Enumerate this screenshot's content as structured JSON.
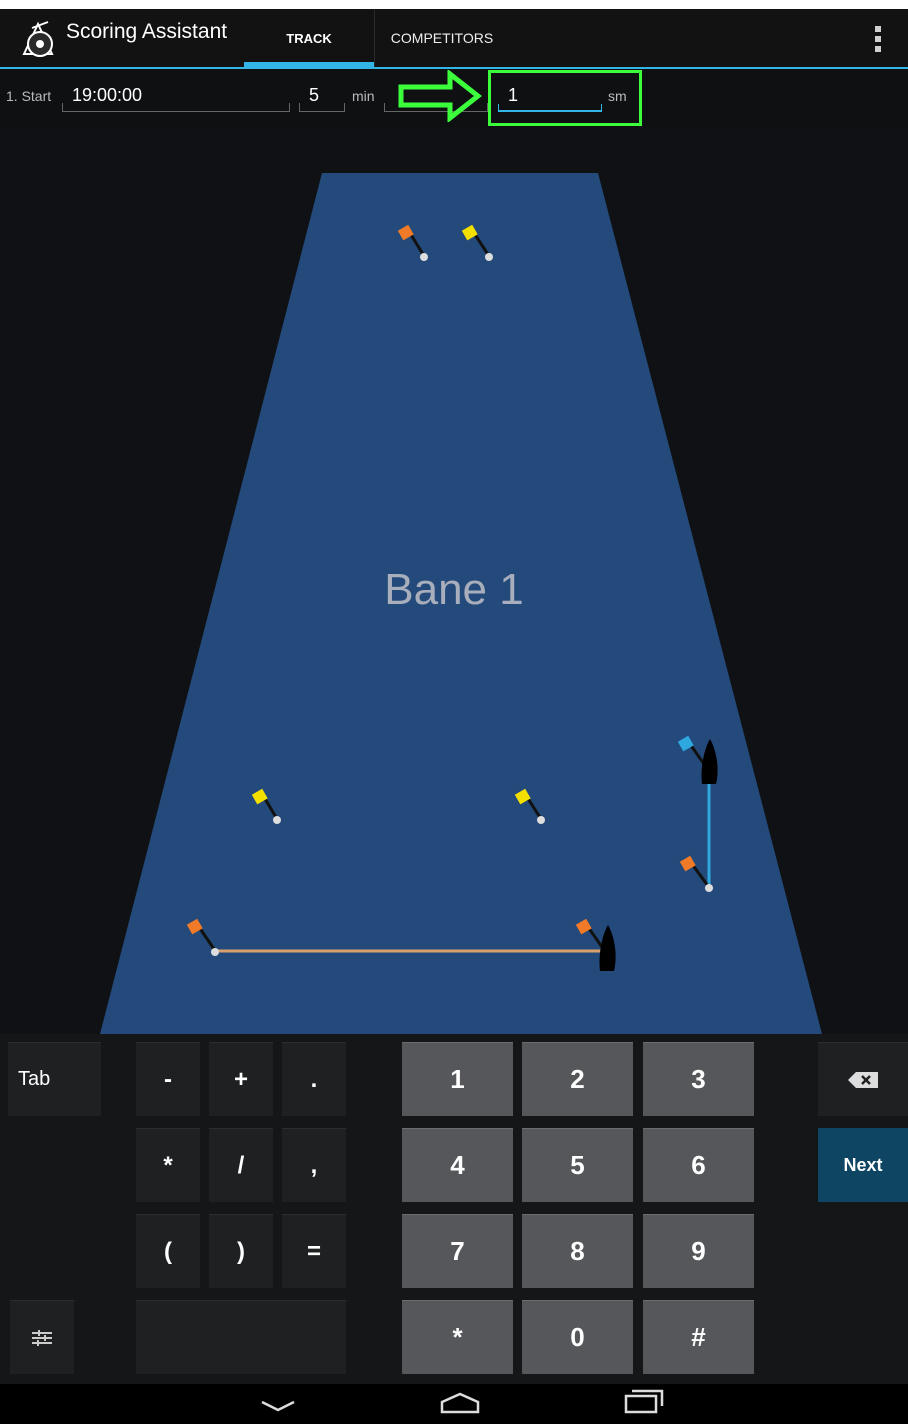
{
  "action_bar": {
    "app_title": "Scoring Assistant",
    "tabs": [
      {
        "label": "TRACK",
        "selected": true
      },
      {
        "label": "COMPETITORS",
        "selected": false
      }
    ],
    "accent_color": "#33b5e5"
  },
  "start_row": {
    "index_label": "1. Start",
    "start_time": "19:00:00",
    "minutes_value": "5",
    "minutes_unit": "min",
    "distance_value": "1",
    "distance_unit": "sm"
  },
  "track": {
    "name": "Bane 1",
    "water_color": "#234a7a"
  },
  "annotation": {
    "highlight_color": "#3cff3c"
  },
  "keyboard": {
    "tab_label": "Tab",
    "symbols": [
      "-",
      "+",
      ".",
      "*",
      "/",
      ",",
      "(",
      ")",
      "="
    ],
    "digits": [
      "1",
      "2",
      "3",
      "4",
      "5",
      "6",
      "7",
      "8",
      "9",
      "*",
      "0",
      "#"
    ],
    "next_label": "Next"
  },
  "icons": {
    "overflow": "overflow-menu-icon",
    "backspace": "backspace-icon",
    "settings": "keyboard-settings-icon",
    "back": "nav-back-icon",
    "home": "nav-home-icon",
    "recents": "nav-recents-icon"
  }
}
